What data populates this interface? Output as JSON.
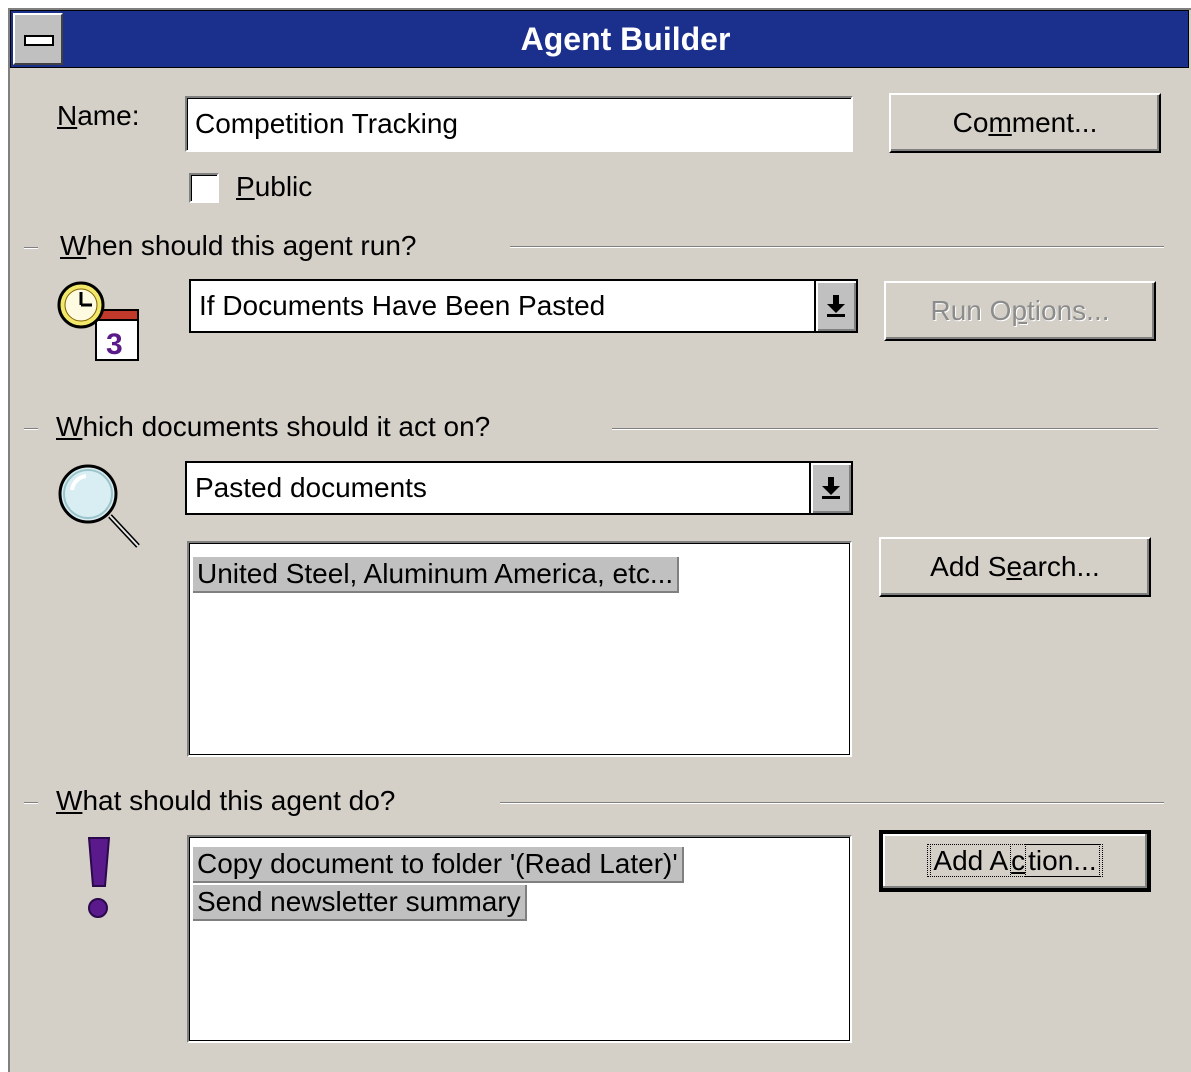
{
  "window": {
    "title": "Agent Builder"
  },
  "name_row": {
    "label_mnemonic": "N",
    "label_rest": "ame:",
    "value": "Competition Tracking",
    "comment_button": {
      "pre": "Co",
      "mnemonic": "m",
      "post": "ment..."
    }
  },
  "public_checkbox": {
    "mnemonic": "P",
    "rest": "ublic",
    "checked": false
  },
  "when_section": {
    "heading_mnemonic": "W",
    "heading_rest": "hen should this agent run?",
    "trigger_value": "If Documents Have Been Pasted",
    "run_options_button": {
      "pre": "Run O",
      "mnemonic": "p",
      "post": "tions...",
      "enabled": false
    },
    "icon": "clock-calendar-icon"
  },
  "which_section": {
    "heading_mnemonic": "W",
    "heading_rest": "hich documents should it act on?",
    "scope_value": "Pasted documents",
    "searches": [
      "United Steel, Aluminum America, etc..."
    ],
    "add_search_button": {
      "pre": "Add S",
      "mnemonic": "e",
      "post": "arch..."
    },
    "icon": "magnifier-icon"
  },
  "what_section": {
    "heading_mnemonic": "W",
    "heading_rest": "hat should this agent do?",
    "actions": [
      "Copy document to folder '(Read Later)'",
      "Send newsletter summary"
    ],
    "add_action_button": {
      "pre": "Add A",
      "mnemonic": "c",
      "post": "tion..."
    },
    "icon": "exclamation-icon"
  },
  "colors": {
    "titlebar": "#1b2f8c",
    "face": "#d4d0c8",
    "accent_purple": "#5a1a8c"
  }
}
